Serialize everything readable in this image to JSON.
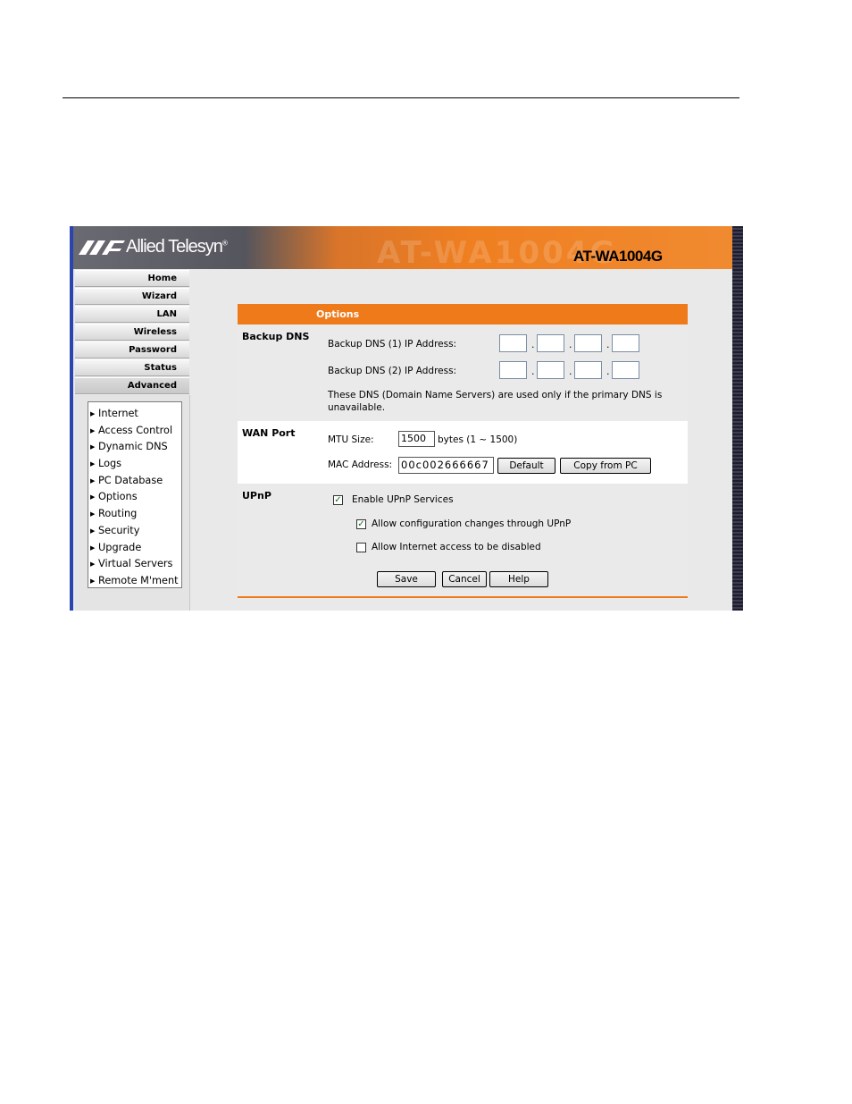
{
  "brand": {
    "company": "Allied Telesyn",
    "model": "AT-WA1004G",
    "watermark": "AT-WA1004G"
  },
  "colors": {
    "accent": "#ef7a1a",
    "banner_dark": "#55555d",
    "panel_grey": "#eaeaea"
  },
  "nav": {
    "buttons": [
      "Home",
      "Wizard",
      "LAN",
      "Wireless",
      "Password",
      "Status",
      "Advanced"
    ],
    "submenu": [
      "Internet",
      "Access Control",
      "Dynamic DNS",
      "Logs",
      "PC Database",
      "Options",
      "Routing",
      "Security",
      "Upgrade",
      "Virtual Servers",
      "Remote M'ment"
    ]
  },
  "panel": {
    "title": "Options",
    "backup_dns": {
      "title": "Backup DNS",
      "dns1_label": "Backup DNS (1) IP Address:",
      "dns2_label": "Backup DNS (2) IP Address:",
      "dns1": [
        "",
        "",
        "",
        ""
      ],
      "dns2": [
        "",
        "",
        "",
        ""
      ],
      "note": "These DNS (Domain Name Servers) are used only if the primary DNS is unavailable."
    },
    "wan_port": {
      "title": "WAN Port",
      "mtu_label": "MTU Size:",
      "mtu_value": "1500",
      "mtu_hint": "bytes (1 ~ 1500)",
      "mac_label": "MAC Address:",
      "mac_value": "00c002666667",
      "default_button": "Default",
      "copy_button": "Copy from PC"
    },
    "upnp": {
      "title": "UPnP",
      "enable_label": "Enable UPnP Services",
      "enable_checked": true,
      "allow_config_label": "Allow configuration changes through UPnP",
      "allow_config_checked": true,
      "allow_disable_label": "Allow Internet access to be disabled",
      "allow_disable_checked": false
    },
    "buttons": {
      "save": "Save",
      "cancel": "Cancel",
      "help": "Help"
    }
  }
}
